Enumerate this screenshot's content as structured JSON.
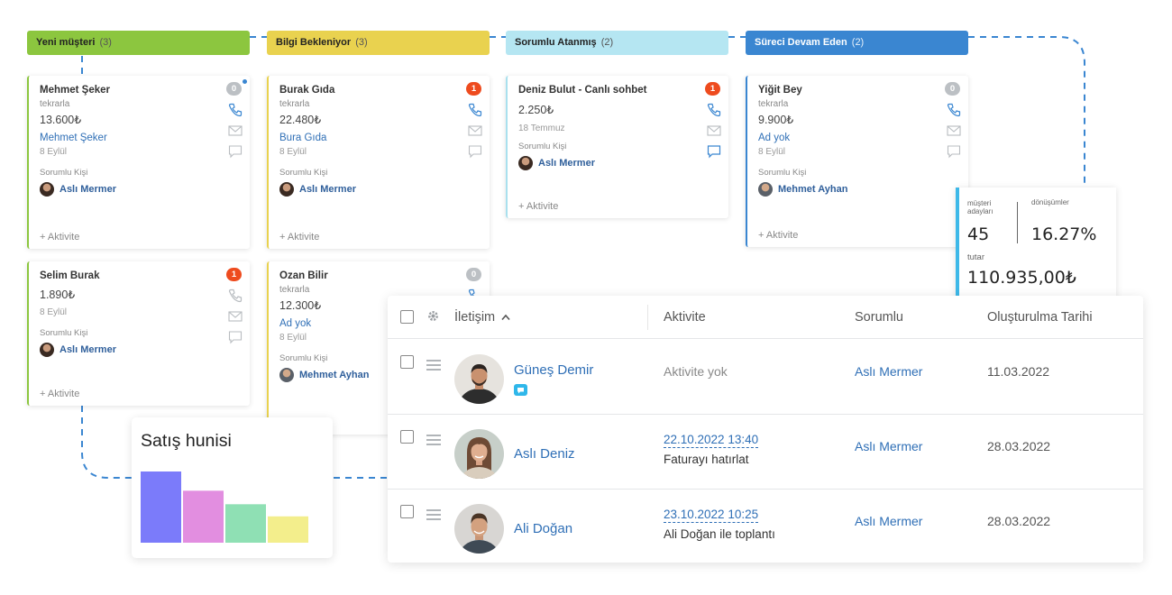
{
  "kanban": {
    "columns": [
      {
        "title": "Yeni müşteri",
        "count": "(3)",
        "color": "#8cc63f"
      },
      {
        "title": "Bilgi Bekleniyor",
        "count": "(3)",
        "color": "#e9d24f"
      },
      {
        "title": "Sorumlu Atanmış",
        "count": "(2)",
        "color": "#b5e6f2"
      },
      {
        "title": "Süreci Devam Eden",
        "count": "(2)",
        "color": "#3a86d1"
      }
    ],
    "responsible_label": "Sorumlu Kişi",
    "add_activity": "+ Aktivite",
    "cards": [
      {
        "title": "Mehmet Şeker",
        "sub": "tekrarla",
        "amount": "13.600₺",
        "link": "Mehmet Şeker",
        "date": "8 Eylül",
        "person": "Aslı Mermer",
        "badge": "0"
      },
      {
        "title": "Selim Burak",
        "amount": "1.890₺",
        "date": "8 Eylül",
        "person": "Aslı Mermer",
        "badge": "1"
      },
      {
        "title": "Burak Gıda",
        "sub": "tekrarla",
        "amount": "22.480₺",
        "link": "Bura Gıda",
        "date": "8 Eylül",
        "person": "Aslı Mermer",
        "badge": "1"
      },
      {
        "title": "Ozan Bilir",
        "sub": "tekrarla",
        "amount": "12.300₺",
        "link": "Ad yok",
        "date": "8 Eylül",
        "person": "Mehmet Ayhan",
        "badge": "0"
      },
      {
        "title": "Deniz Bulut - Canlı sohbet",
        "amount": "2.250₺",
        "date": "18 Temmuz",
        "person": "Aslı Mermer",
        "badge": "1"
      },
      {
        "title": "Yiğit Bey",
        "sub": "tekrarla",
        "amount": "9.900₺",
        "link": "Ad yok",
        "date": "8 Eylül",
        "person": "Mehmet Ayhan",
        "badge": "0"
      }
    ]
  },
  "stats": {
    "leads_label": "müşteri adayları",
    "leads_value": "45",
    "conv_label": "dönüşümler",
    "conv_value": "16.27%",
    "amount_label": "tutar",
    "amount_value": "110.935,00₺"
  },
  "funnel": {
    "title": "Satış hunisi",
    "colors": [
      "#7b7bfa",
      "#e28ee0",
      "#8fe0b4",
      "#f3ee8c"
    ]
  },
  "chart_data": {
    "type": "bar",
    "title": "Satış hunisi",
    "categories": [
      "",
      "",
      "",
      ""
    ],
    "values": [
      100,
      73,
      54,
      37
    ],
    "ylim": [
      0,
      100
    ],
    "grid": false,
    "legend": "none"
  },
  "table": {
    "headers": {
      "contact": "İletişim",
      "activity": "Aktivite",
      "responsible": "Sorumlu",
      "created": "Oluşturulma Tarihi"
    },
    "rows": [
      {
        "name": "Güneş Demir",
        "activity": "Aktivite yok",
        "responsible": "Aslı Mermer",
        "created": "11.03.2022"
      },
      {
        "name": "Aslı Deniz",
        "activity_date": "22.10.2022 13:40",
        "activity_text": "Faturayı hatırlat",
        "responsible": "Aslı Mermer",
        "created": "28.03.2022"
      },
      {
        "name": "Ali Doğan",
        "activity_date": "23.10.2022 10:25",
        "activity_text": "Ali Doğan ile toplantı",
        "responsible": "Aslı Mermer",
        "created": "28.03.2022"
      }
    ]
  }
}
